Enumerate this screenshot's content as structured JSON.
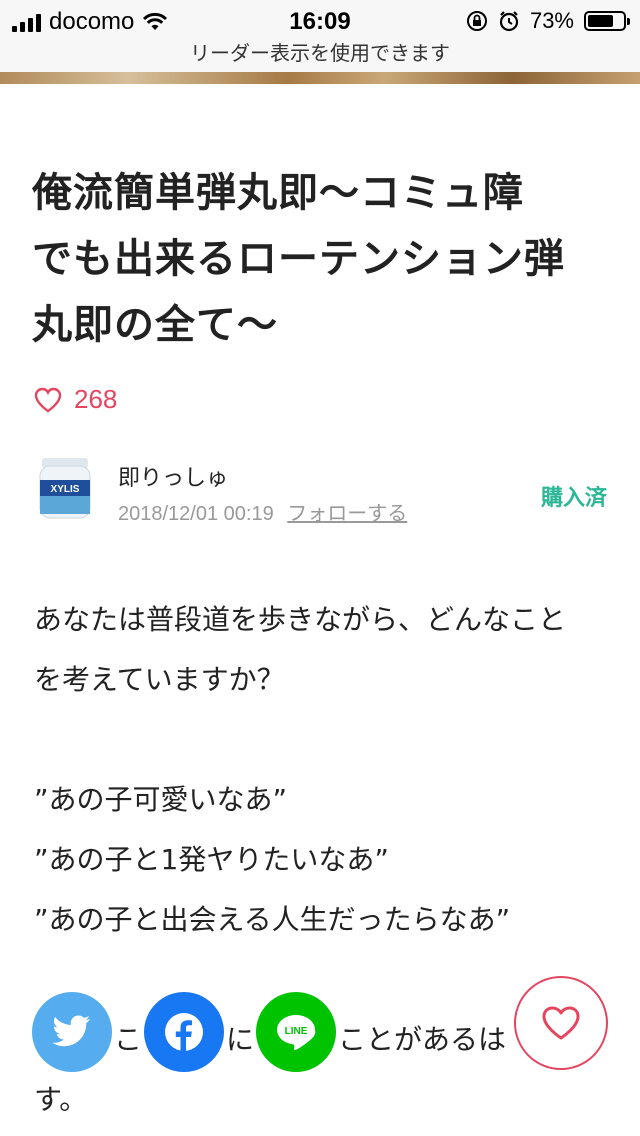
{
  "status_bar": {
    "carrier": "docomo",
    "time": "16:09",
    "battery_text": "73%",
    "battery_level": 0.73
  },
  "reader_bar": {
    "label": "リーダー表示を使用できます"
  },
  "article": {
    "title_lines": [
      "俺流簡単弾丸即〜コミュ障",
      "でも出来るローテンション弾",
      "丸即の全て〜"
    ],
    "like_count": "268",
    "author": {
      "name": "即りっしゅ",
      "date": "2018/12/01 00:19",
      "follow_label": "フォローする",
      "avatar_text": "XYLIS"
    },
    "purchase_status": "購入済",
    "body": {
      "p1_line1": "あなたは普段道を歩きながら、どんなこと",
      "p1_line2": "を考えていますか？",
      "q1": "”あの子可愛いなあ”",
      "q2": "”あの子と1発ヤりたいなあ”",
      "q3": "”あの子と出会える人生だったらなあ”",
      "p2_line1": "こ　　　に　　　ことがあるは",
      "p2_line2": "す。"
    }
  },
  "share": {
    "line_label": "LINE"
  },
  "colors": {
    "accent_pink": "#e5455f",
    "purchased_green": "#2cb696",
    "twitter": "#55acee",
    "facebook": "#1877f2",
    "line": "#00c300"
  }
}
